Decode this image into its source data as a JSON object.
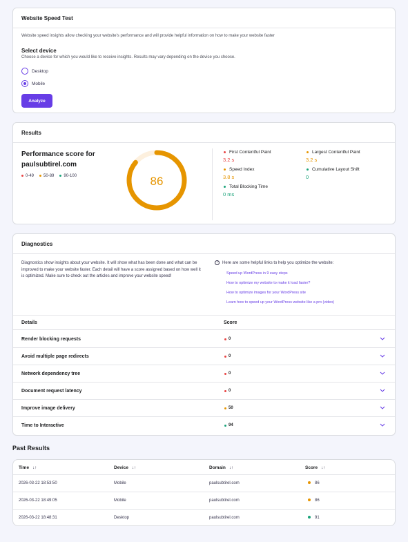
{
  "colors": {
    "accent": "#673de6",
    "red": "#e84545",
    "orange": "#e69500",
    "green": "#1aa37a"
  },
  "speed_test": {
    "title": "Website Speed Test",
    "description": "Website speed insights allow checking your website's performance and will provide helpful information on how to make your website faster",
    "select_title": "Select device",
    "select_description": "Choose a device for which you would like to receive insights. Results may vary depending on the device you choose.",
    "options": [
      {
        "label": "Desktop",
        "checked": false
      },
      {
        "label": "Mobile",
        "checked": true
      }
    ],
    "analyze_label": "Analyze"
  },
  "results": {
    "title": "Results",
    "performance_title": "Performance score for paulsubtirel.com",
    "legend": [
      {
        "label": "0-49",
        "color": "#e84545"
      },
      {
        "label": "50-89",
        "color": "#e69500"
      },
      {
        "label": "90-100",
        "color": "#1aa37a"
      }
    ],
    "score": "86",
    "score_fraction": 0.86,
    "metrics": [
      {
        "label": "First Contentful Paint",
        "value": "3.2 s",
        "color": "#e84545"
      },
      {
        "label": "Largest Contentful Paint",
        "value": "3.2 s",
        "color": "#e69500"
      },
      {
        "label": "Speed Index",
        "value": "3.8 s",
        "color": "#e69500"
      },
      {
        "label": "Cumulative Layout Shift",
        "value": "0",
        "color": "#1aa37a"
      },
      {
        "label": "Total Blocking Time",
        "value": "0 ms",
        "color": "#1aa37a"
      }
    ]
  },
  "diagnostics": {
    "title": "Diagnostics",
    "description": "Diagnostics show insights about your website. It will show what has been done and what can be improved to make your website faster. Each detail will have a score assigned based on how well it is optimized. Make sure to check out the articles and improve your website speed!",
    "help_title": "Here are some helpful links to help you optimize the website:",
    "links": [
      "Speed up WordPress in 9 easy steps",
      "How to optimize my website to make it load faster?",
      "How to optimize images for your WordPress site",
      "Learn how to speed up your WordPress website like a pro (video)"
    ],
    "col_details": "Details",
    "col_score": "Score",
    "rows": [
      {
        "name": "Render blocking requests",
        "score": "0",
        "color": "#e84545"
      },
      {
        "name": "Avoid multiple page redirects",
        "score": "0",
        "color": "#e84545"
      },
      {
        "name": "Network dependency tree",
        "score": "0",
        "color": "#e84545"
      },
      {
        "name": "Document request latency",
        "score": "0",
        "color": "#e84545"
      },
      {
        "name": "Improve image delivery",
        "score": "50",
        "color": "#e69500"
      },
      {
        "name": "Time to Interactive",
        "score": "94",
        "color": "#1aa37a"
      }
    ]
  },
  "past_results": {
    "title": "Past Results",
    "columns": [
      "Time",
      "Device",
      "Domain",
      "Score"
    ],
    "rows": [
      {
        "time": "2026-03-22 18:53:50",
        "device": "Mobile",
        "domain": "paulsubtirel.com",
        "score": "86",
        "color": "#e69500"
      },
      {
        "time": "2026-03-22 18:49:05",
        "device": "Mobile",
        "domain": "paulsubtirel.com",
        "score": "86",
        "color": "#e69500"
      },
      {
        "time": "2026-03-22 18:48:31",
        "device": "Desktop",
        "domain": "paulsubtirel.com",
        "score": "91",
        "color": "#1aa37a"
      }
    ]
  }
}
